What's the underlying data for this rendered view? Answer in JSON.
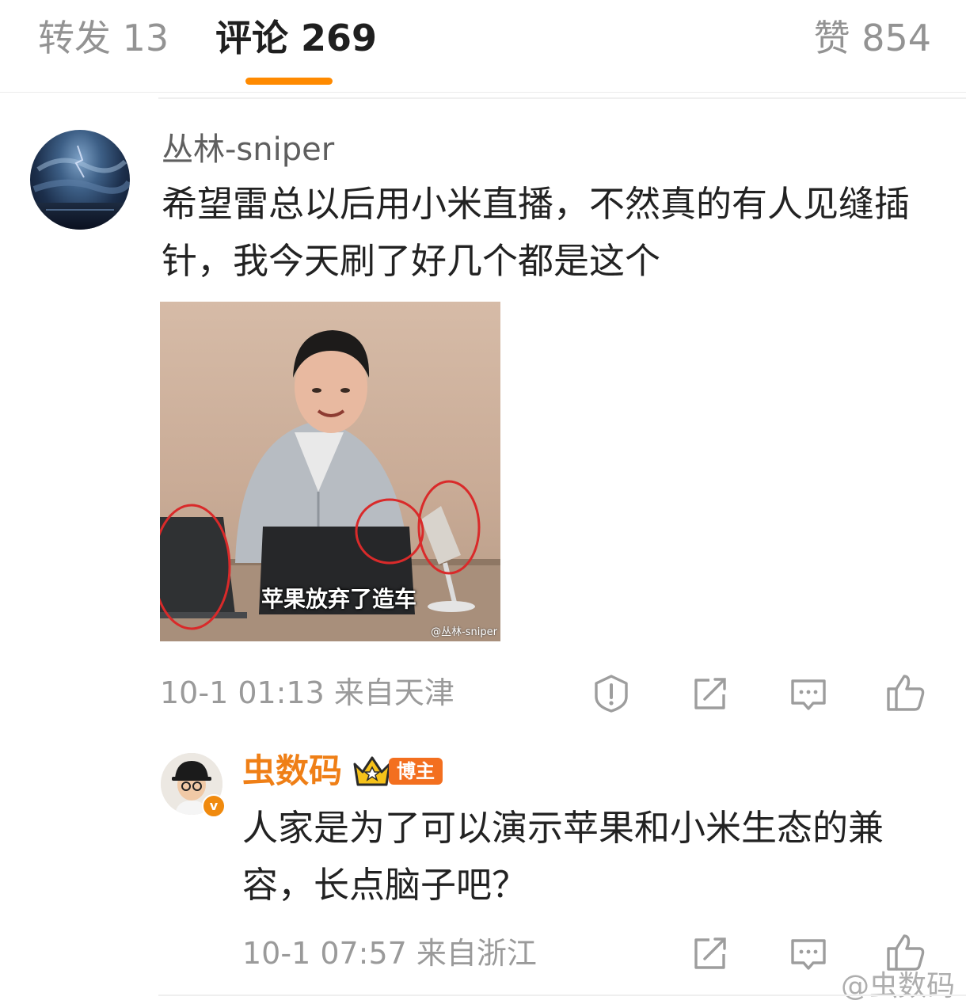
{
  "tabs": {
    "forward": "转发 13",
    "comments": "评论 269",
    "likes": "赞 854"
  },
  "comment": {
    "username": "丛林-sniper",
    "text": "希望雷总以后用小米直播，不然真的有人见缝插针，我今天刷了好几个都是这个",
    "image_caption": "苹果放弃了造车",
    "image_watermark": "@丛林-sniper",
    "time_location": "10-1 01:13  来自天津",
    "actions": [
      "report-icon",
      "repost-icon",
      "comment-icon",
      "like-icon"
    ]
  },
  "reply": {
    "username": "虫数码",
    "badge": "博主",
    "verified_mark": "v",
    "text": "人家是为了可以演示苹果和小米生态的兼容，长点脑子吧？",
    "time_location": "10-1 07:57  来自浙江",
    "actions": [
      "repost-icon",
      "comment-icon",
      "like-icon"
    ]
  },
  "page_watermark": "@虫数码",
  "colors": {
    "accent": "#ff8a00",
    "reply_name": "#ef7f16",
    "badge": "#f36f1f",
    "meta_text": "#9a9a9a"
  }
}
